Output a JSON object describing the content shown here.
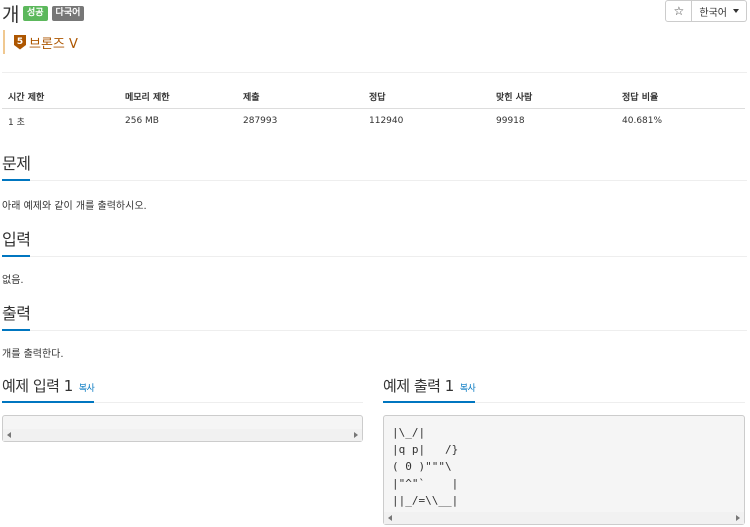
{
  "problem": {
    "title": "개",
    "labels": [
      "성공",
      "다국어"
    ],
    "tier": {
      "level": "5",
      "name": "브론즈 V"
    }
  },
  "toolbar": {
    "star_icon": "☆",
    "language": "한국어"
  },
  "info_table": {
    "headers": [
      "시간 제한",
      "메모리 제한",
      "제출",
      "정답",
      "맞힌 사람",
      "정답 비율"
    ],
    "values": [
      "1 초",
      "256 MB",
      "287993",
      "112940",
      "99918",
      "40.681%"
    ]
  },
  "sections": {
    "description": {
      "title": "문제",
      "text": "아래 예제와 같이 개를 출력하시오."
    },
    "input": {
      "title": "입력",
      "text": "없음."
    },
    "output": {
      "title": "출력",
      "text": "개를 출력한다."
    }
  },
  "samples": {
    "input": {
      "title": "예제 입력 1",
      "copy": "복사",
      "content": ""
    },
    "output": {
      "title": "예제 출력 1",
      "copy": "복사",
      "content": "|\\_/|\n|q p|   /}\n( 0 )\"\"\"\\\n|\"^\"`    |\n||_/=\\\\__|"
    }
  },
  "colors": {
    "success": "#5cb85c",
    "multi": "#777777",
    "bronze": "#ad5600",
    "accent": "#0076c0"
  }
}
